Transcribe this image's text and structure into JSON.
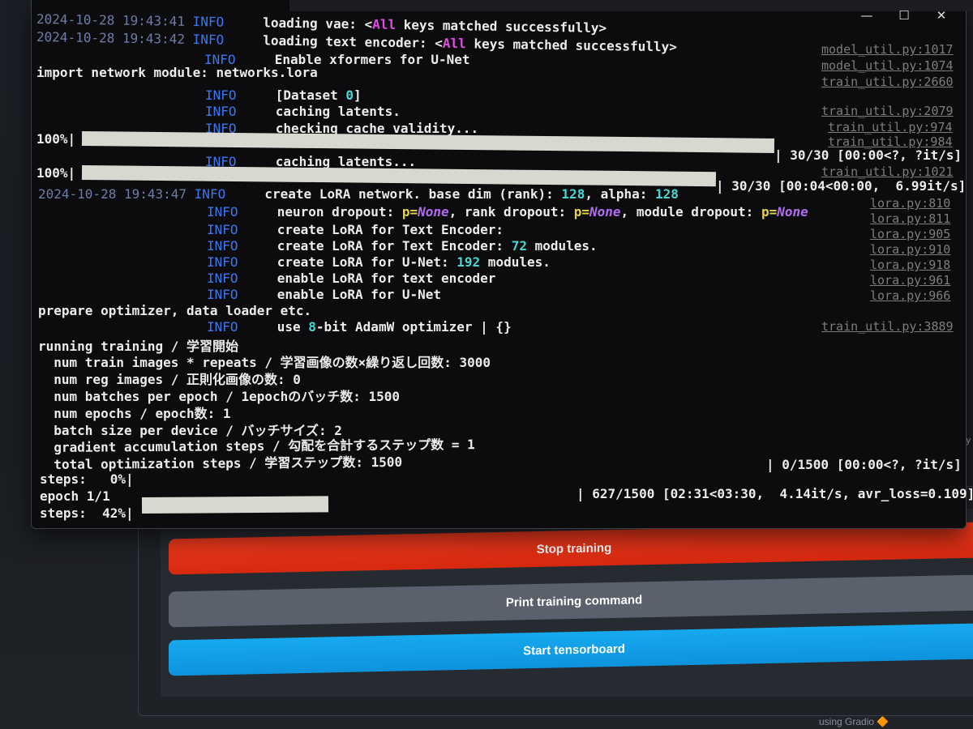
{
  "terminal": {
    "window_controls": {
      "minimize": "—",
      "maximize": "☐",
      "close": "✕"
    },
    "lines": [
      {
        "ts": "2024-10-28 19:43:41",
        "level": "INFO",
        "pre": "loading vae: <",
        "kw": "All",
        "post": " keys matched successfully>",
        "src": "model_util.py:1017"
      },
      {
        "ts": "2024-10-28 19:43:42",
        "level": "INFO",
        "pre": "loading text encoder: <",
        "kw": "All",
        "post": " keys matched successfully>",
        "src": "model_util.py:1074"
      },
      {
        "level": "INFO",
        "text": "Enable xformers for U-Net",
        "src": "train_util.py:2660"
      },
      {
        "text": "import network module: networks.lora"
      },
      {
        "level": "INFO",
        "pre": "[Dataset ",
        "num": "0",
        "post": "]"
      },
      {
        "level": "INFO",
        "text": "caching latents.",
        "src": "train_util.py:2079"
      },
      {
        "level": "INFO",
        "text": "checking cache validity...",
        "src1": "train_util.py:974",
        "src2": "train_util.py:984"
      },
      {
        "pct": "100%|",
        "stats": "| 30/30 [00:00<?, ?it/s]",
        "progress": 1.0
      },
      {
        "level": "INFO",
        "text": "caching latents..."
      },
      {
        "pct": "100%|",
        "stats": "| 30/30 [00:04<00:00,  6.99it/s]",
        "progress": 1.0,
        "src": "train_util.py:1021"
      },
      {
        "ts": "2024-10-28 19:43:47",
        "level": "INFO",
        "pre": "create LoRA network. base dim (rank): ",
        "n1": "128",
        "mid": ", alpha: ",
        "n2": "128",
        "src": "lora.py:810"
      },
      {
        "level": "INFO",
        "t1": "neuron dropout: ",
        "p": "p=",
        "none": "None",
        "t2": ", rank dropout: ",
        "t3": ", module dropout: ",
        "src": "lora.py:811"
      },
      {
        "level": "INFO",
        "text": "create LoRA for Text Encoder:",
        "src": "lora.py:905"
      },
      {
        "level": "INFO",
        "pre": "create LoRA for Text Encoder: ",
        "num": "72",
        "post": " modules.",
        "src": "lora.py:910"
      },
      {
        "level": "INFO",
        "pre": "create LoRA for U-Net: ",
        "num": "192",
        "post": " modules.",
        "src": "lora.py:918"
      },
      {
        "level": "INFO",
        "text": "enable LoRA for text encoder",
        "src": "lora.py:961"
      },
      {
        "level": "INFO",
        "text": "enable LoRA for U-Net",
        "src": "lora.py:966"
      },
      {
        "text": "prepare optimizer, data loader etc."
      },
      {
        "level": "INFO",
        "pre": "use ",
        "num": "8",
        "post": "-bit AdamW optimizer | {}",
        "src": "train_util.py:3889"
      },
      {
        "text": "running training / 学習開始"
      },
      {
        "text": "  num train images * repeats / 学習画像の数×繰り返し回数: 3000"
      },
      {
        "text": "  num reg images / 正則化画像の数: 0"
      },
      {
        "text": "  num batches per epoch / 1epochのバッチ数: 1500"
      },
      {
        "text": "  num epochs / epoch数: 1"
      },
      {
        "text": "  batch size per device / バッチサイズ: 2"
      },
      {
        "text": "  gradient accumulation steps / 勾配を合計するステップ数 = 1"
      },
      {
        "text": "  total optimization steps / 学習ステップ数: 1500"
      },
      {
        "stats": "| 0/1500 [00:00<?, ?it/s]"
      },
      {
        "text": "steps:   0%|"
      },
      {
        "text": "epoch 1/1",
        "stats": "| 627/1500 [02:31<03:30,  4.14it/s, avr_loss=0.109]"
      },
      {
        "text": "steps:  42%|",
        "progress": 0.42
      }
    ]
  },
  "gradio": {
    "stop_label": "Stop training",
    "print_label": "Print training command",
    "tensorboard_label": "Start tensorboard",
    "footer": "using Gradio 🔶",
    "side_text": "sy",
    "colors": {
      "stop": "#e8351a",
      "print": "#5a606c",
      "tensorboard": "#14a2e8"
    }
  }
}
